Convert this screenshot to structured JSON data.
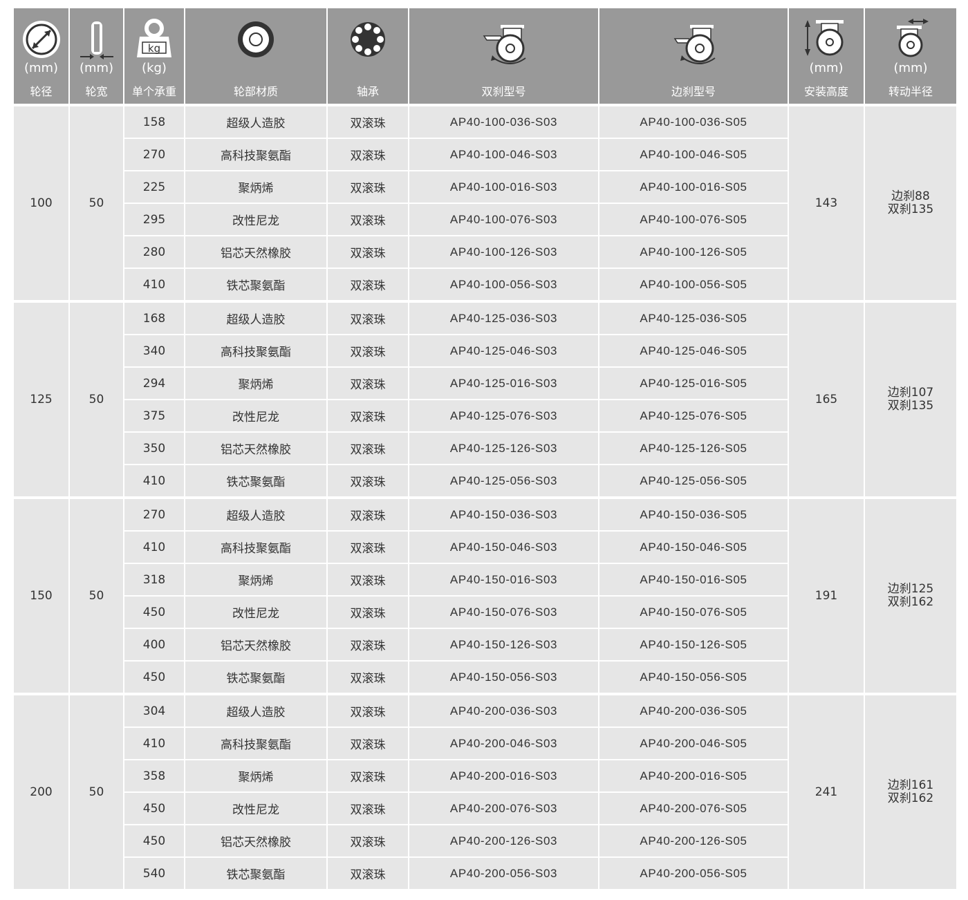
{
  "header": {
    "diameter": {
      "unit": "(mm)",
      "label": "轮径",
      "icon": "wheel-diameter-icon"
    },
    "width": {
      "unit": "(mm)",
      "label": "轮宽",
      "icon": "wheel-width-icon"
    },
    "load": {
      "unit": "(kg)",
      "label": "单个承重",
      "icon": "weight-icon",
      "icon_text": "kg"
    },
    "material": {
      "label": "轮部材质",
      "icon": "wheel-material-icon"
    },
    "bearing": {
      "label": "轴承",
      "icon": "ball-bearing-icon"
    },
    "double_brake": {
      "label": "双刹型号",
      "icon": "double-brake-caster-icon"
    },
    "side_brake": {
      "label": "边刹型号",
      "icon": "side-brake-caster-icon"
    },
    "height": {
      "unit": "(mm)",
      "label": "安装高度",
      "icon": "mounting-height-icon"
    },
    "radius": {
      "unit": "(mm)",
      "label": "转动半径",
      "icon": "swivel-radius-icon"
    }
  },
  "groups": [
    {
      "diameter": "100",
      "width": "50",
      "height": "143",
      "radius_side": "边刹88",
      "radius_double": "双刹135",
      "rows": [
        {
          "load": "158",
          "material": "超级人造胶",
          "bearing": "双滚珠",
          "double_model": "AP40-100-036-S03",
          "side_model": "AP40-100-036-S05"
        },
        {
          "load": "270",
          "material": "高科技聚氨酯",
          "bearing": "双滚珠",
          "double_model": "AP40-100-046-S03",
          "side_model": "AP40-100-046-S05"
        },
        {
          "load": "225",
          "material": "聚炳烯",
          "bearing": "双滚珠",
          "double_model": "AP40-100-016-S03",
          "side_model": "AP40-100-016-S05"
        },
        {
          "load": "295",
          "material": "改性尼龙",
          "bearing": "双滚珠",
          "double_model": "AP40-100-076-S03",
          "side_model": "AP40-100-076-S05"
        },
        {
          "load": "280",
          "material": "铝芯天然橡胶",
          "bearing": "双滚珠",
          "double_model": "AP40-100-126-S03",
          "side_model": "AP40-100-126-S05"
        },
        {
          "load": "410",
          "material": "铁芯聚氨酯",
          "bearing": "双滚珠",
          "double_model": "AP40-100-056-S03",
          "side_model": "AP40-100-056-S05"
        }
      ]
    },
    {
      "diameter": "125",
      "width": "50",
      "height": "165",
      "radius_side": "边刹107",
      "radius_double": "双刹135",
      "rows": [
        {
          "load": "168",
          "material": "超级人造胶",
          "bearing": "双滚珠",
          "double_model": "AP40-125-036-S03",
          "side_model": "AP40-125-036-S05"
        },
        {
          "load": "340",
          "material": "高科技聚氨酯",
          "bearing": "双滚珠",
          "double_model": "AP40-125-046-S03",
          "side_model": "AP40-125-046-S05"
        },
        {
          "load": "294",
          "material": "聚炳烯",
          "bearing": "双滚珠",
          "double_model": "AP40-125-016-S03",
          "side_model": "AP40-125-016-S05"
        },
        {
          "load": "375",
          "material": "改性尼龙",
          "bearing": "双滚珠",
          "double_model": "AP40-125-076-S03",
          "side_model": "AP40-125-076-S05"
        },
        {
          "load": "350",
          "material": "铝芯天然橡胶",
          "bearing": "双滚珠",
          "double_model": "AP40-125-126-S03",
          "side_model": "AP40-125-126-S05"
        },
        {
          "load": "410",
          "material": "铁芯聚氨酯",
          "bearing": "双滚珠",
          "double_model": "AP40-125-056-S03",
          "side_model": "AP40-125-056-S05"
        }
      ]
    },
    {
      "diameter": "150",
      "width": "50",
      "height": "191",
      "radius_side": "边刹125",
      "radius_double": "双刹162",
      "rows": [
        {
          "load": "270",
          "material": "超级人造胶",
          "bearing": "双滚珠",
          "double_model": "AP40-150-036-S03",
          "side_model": "AP40-150-036-S05"
        },
        {
          "load": "410",
          "material": "高科技聚氨酯",
          "bearing": "双滚珠",
          "double_model": "AP40-150-046-S03",
          "side_model": "AP40-150-046-S05"
        },
        {
          "load": "318",
          "material": "聚炳烯",
          "bearing": "双滚珠",
          "double_model": "AP40-150-016-S03",
          "side_model": "AP40-150-016-S05"
        },
        {
          "load": "450",
          "material": "改性尼龙",
          "bearing": "双滚珠",
          "double_model": "AP40-150-076-S03",
          "side_model": "AP40-150-076-S05"
        },
        {
          "load": "400",
          "material": "铝芯天然橡胶",
          "bearing": "双滚珠",
          "double_model": "AP40-150-126-S03",
          "side_model": "AP40-150-126-S05"
        },
        {
          "load": "450",
          "material": "铁芯聚氨酯",
          "bearing": "双滚珠",
          "double_model": "AP40-150-056-S03",
          "side_model": "AP40-150-056-S05"
        }
      ]
    },
    {
      "diameter": "200",
      "width": "50",
      "height": "241",
      "radius_side": "边刹161",
      "radius_double": "双刹162",
      "rows": [
        {
          "load": "304",
          "material": "超级人造胶",
          "bearing": "双滚珠",
          "double_model": "AP40-200-036-S03",
          "side_model": "AP40-200-036-S05"
        },
        {
          "load": "410",
          "material": "高科技聚氨酯",
          "bearing": "双滚珠",
          "double_model": "AP40-200-046-S03",
          "side_model": "AP40-200-046-S05"
        },
        {
          "load": "358",
          "material": "聚炳烯",
          "bearing": "双滚珠",
          "double_model": "AP40-200-016-S03",
          "side_model": "AP40-200-016-S05"
        },
        {
          "load": "450",
          "material": "改性尼龙",
          "bearing": "双滚珠",
          "double_model": "AP40-200-076-S03",
          "side_model": "AP40-200-076-S05"
        },
        {
          "load": "450",
          "material": "铝芯天然橡胶",
          "bearing": "双滚珠",
          "double_model": "AP40-200-126-S03",
          "side_model": "AP40-200-126-S05"
        },
        {
          "load": "540",
          "material": "铁芯聚氨酯",
          "bearing": "双滚珠",
          "double_model": "AP40-200-056-S03",
          "side_model": "AP40-200-056-S05"
        }
      ]
    }
  ],
  "colors": {
    "header_bg": "#999999",
    "body_bg": "#e6e6e6",
    "divider": "#ffffff",
    "text": "#333333"
  }
}
